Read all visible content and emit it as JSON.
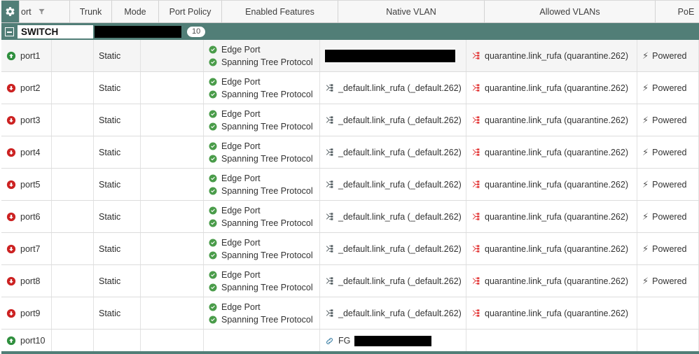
{
  "header": {
    "gear_icon": "gear-icon",
    "columns": [
      {
        "key": "port",
        "label": "ort",
        "icon": "filter-icon"
      },
      {
        "key": "trunk",
        "label": "Trunk"
      },
      {
        "key": "mode",
        "label": "Mode"
      },
      {
        "key": "policy",
        "label": "Port Policy"
      },
      {
        "key": "features",
        "label": "Enabled Features"
      },
      {
        "key": "native",
        "label": "Native VLAN"
      },
      {
        "key": "allowed",
        "label": "Allowed VLANs"
      },
      {
        "key": "poe",
        "label": "PoE"
      }
    ]
  },
  "group_row": {
    "expander_icon": "collapse-icon",
    "name": "SWITCH",
    "redacted": "",
    "count": "10"
  },
  "rows": [
    {
      "port": "port1",
      "status_icon": "port-up-icon",
      "status_color": "#2f8f3e",
      "trunk": "",
      "mode": "Static",
      "policy": "",
      "features": [
        "Edge Port",
        "Spanning Tree Protocol"
      ],
      "native": "",
      "native_redacted": true,
      "allowed": "quarantine.link_rufa (quarantine.262)",
      "poe": "Powered"
    },
    {
      "port": "port2",
      "status_icon": "port-down-icon",
      "status_color": "#cc2222",
      "trunk": "",
      "mode": "Static",
      "policy": "",
      "features": [
        "Edge Port",
        "Spanning Tree Protocol"
      ],
      "native": "_default.link_rufa (_default.262)",
      "native_redacted": false,
      "allowed": "quarantine.link_rufa (quarantine.262)",
      "poe": "Powered"
    },
    {
      "port": "port3",
      "status_icon": "port-down-icon",
      "status_color": "#cc2222",
      "trunk": "",
      "mode": "Static",
      "policy": "",
      "features": [
        "Edge Port",
        "Spanning Tree Protocol"
      ],
      "native": "_default.link_rufa (_default.262)",
      "native_redacted": false,
      "allowed": "quarantine.link_rufa (quarantine.262)",
      "poe": "Powered"
    },
    {
      "port": "port4",
      "status_icon": "port-down-icon",
      "status_color": "#cc2222",
      "trunk": "",
      "mode": "Static",
      "policy": "",
      "features": [
        "Edge Port",
        "Spanning Tree Protocol"
      ],
      "native": "_default.link_rufa (_default.262)",
      "native_redacted": false,
      "allowed": "quarantine.link_rufa (quarantine.262)",
      "poe": "Powered"
    },
    {
      "port": "port5",
      "status_icon": "port-down-icon",
      "status_color": "#cc2222",
      "trunk": "",
      "mode": "Static",
      "policy": "",
      "features": [
        "Edge Port",
        "Spanning Tree Protocol"
      ],
      "native": "_default.link_rufa (_default.262)",
      "native_redacted": false,
      "allowed": "quarantine.link_rufa (quarantine.262)",
      "poe": "Powered"
    },
    {
      "port": "port6",
      "status_icon": "port-down-icon",
      "status_color": "#cc2222",
      "trunk": "",
      "mode": "Static",
      "policy": "",
      "features": [
        "Edge Port",
        "Spanning Tree Protocol"
      ],
      "native": "_default.link_rufa (_default.262)",
      "native_redacted": false,
      "allowed": "quarantine.link_rufa (quarantine.262)",
      "poe": "Powered"
    },
    {
      "port": "port7",
      "status_icon": "port-down-icon",
      "status_color": "#cc2222",
      "trunk": "",
      "mode": "Static",
      "policy": "",
      "features": [
        "Edge Port",
        "Spanning Tree Protocol"
      ],
      "native": "_default.link_rufa (_default.262)",
      "native_redacted": false,
      "allowed": "quarantine.link_rufa (quarantine.262)",
      "poe": "Powered"
    },
    {
      "port": "port8",
      "status_icon": "port-down-icon",
      "status_color": "#cc2222",
      "trunk": "",
      "mode": "Static",
      "policy": "",
      "features": [
        "Edge Port",
        "Spanning Tree Protocol"
      ],
      "native": "_default.link_rufa (_default.262)",
      "native_redacted": false,
      "allowed": "quarantine.link_rufa (quarantine.262)",
      "poe": "Powered"
    },
    {
      "port": "port9",
      "status_icon": "port-down-icon",
      "status_color": "#cc2222",
      "trunk": "",
      "mode": "Static",
      "policy": "",
      "features": [
        "Edge Port",
        "Spanning Tree Protocol"
      ],
      "native": "_default.link_rufa (_default.262)",
      "native_redacted": false,
      "allowed": "quarantine.link_rufa (quarantine.262)",
      "poe": ""
    },
    {
      "port": "port10",
      "status_icon": "port-up-icon",
      "status_color": "#2f8f3e",
      "trunk": "",
      "mode": "",
      "policy": "",
      "features": [],
      "native": "FG",
      "native_redacted": "partial",
      "native_icon": "link-icon",
      "allowed": "",
      "poe": ""
    }
  ],
  "colors": {
    "accent_teal": "#517e77",
    "status_ok_green": "#4a9c4a",
    "vlan_icon_red": "#e33a3a",
    "vlan_icon_gray": "#555f63",
    "link_icon_blue": "#3c7fa5"
  }
}
